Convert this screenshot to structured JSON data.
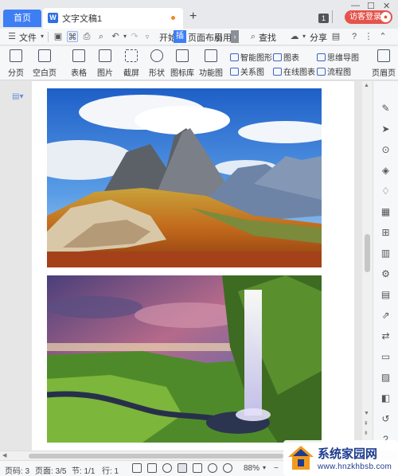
{
  "titlebar": {
    "home_tab": "首页",
    "doc_tab": "文字文稿1",
    "new_tab": "+",
    "page_count_badge": "1",
    "guest_login": "访客登录"
  },
  "menubar": {
    "file": "文件",
    "start": "开始",
    "insert": "插入",
    "page_layout": "页面布局",
    "ref": "引用",
    "find": "查找",
    "share": "分享"
  },
  "ribbon": {
    "page_break": "分页",
    "blank_page": "空白页",
    "table": "表格",
    "picture": "图片",
    "screenshot": "截屏",
    "shape": "形状",
    "icon_lib": "图标库",
    "function_chart": "功能图",
    "smart_shape": "智能图形",
    "chart": "图表",
    "mind_map": "思维导图",
    "relation_chart": "关系图",
    "online_chart": "在线图表",
    "flow_chart": "流程图",
    "header_footer": "页眉页"
  },
  "status": {
    "page_num": "页码: 3",
    "pages": "页面: 3/5",
    "section": "节: 1/1",
    "row": "行: 1",
    "zoom": "88%"
  },
  "watermark": {
    "title": "系统家园网",
    "url": "www.hnzkhbsb.com"
  },
  "colors": {
    "accent": "#3d7ef5",
    "guest_button": "#e5534b",
    "watermark_blue": "#1d3c8f",
    "watermark_orange": "#f39a1e"
  }
}
